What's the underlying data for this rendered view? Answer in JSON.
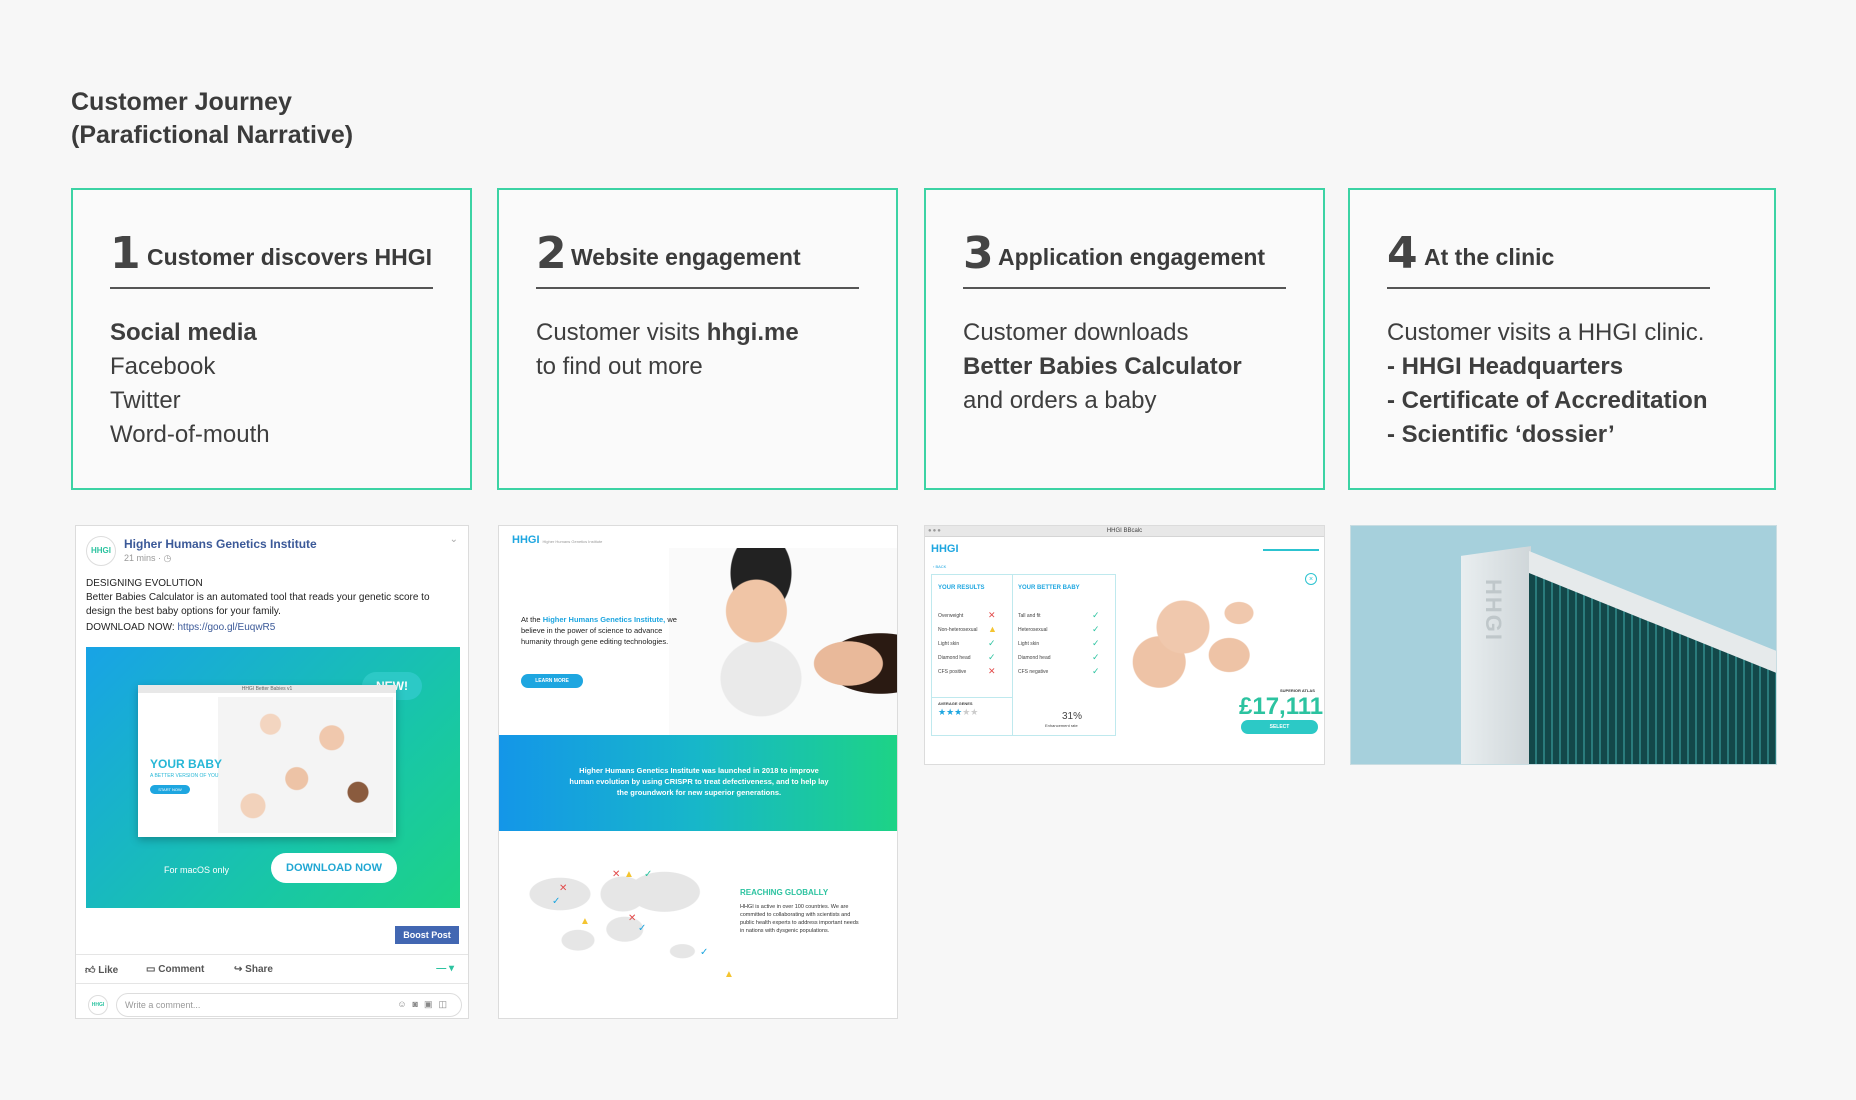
{
  "page": {
    "title_line1": "Customer Journey",
    "title_line2": "(Parafictional Narrative)"
  },
  "steps": [
    {
      "num": "1",
      "heading": "Customer discovers HHGI",
      "lines": [
        "Social media",
        "Facebook",
        "Twitter",
        "Word-of-mouth"
      ]
    },
    {
      "num": "2",
      "heading": "Website engagement",
      "line1_pre": "Customer visits ",
      "line1_bold": "hhgi.me",
      "line2": "to find out more"
    },
    {
      "num": "3",
      "heading": "Application engagement",
      "lines": [
        "Customer downloads",
        "Better Babies Calculator",
        "and orders a baby"
      ]
    },
    {
      "num": "4",
      "heading": "At the clinic",
      "lines": [
        "Customer visits a HHGI clinic.",
        "- HHGI Headquarters",
        "- Certificate of Accreditation",
        "- Scientific ‘dossier’"
      ]
    }
  ],
  "facebook": {
    "logo": "HHGI",
    "page_name": "Higher Humans Genetics Institute",
    "meta": "21 mins · ◷",
    "post_title": "DESIGNING EVOLUTION",
    "post_body": "Better Babies Calculator is an automated tool that reads your genetic score to design the best baby options for your family.",
    "download_label": "DOWNLOAD NOW: ",
    "download_link": "https://goo.gl/EuqwR5",
    "ad_badge": "NEW!",
    "ad_window_title": "HHGI Better Babies v1",
    "ad_heading": "YOUR BABY",
    "ad_sub": "A BETTER VERSION OF YOU",
    "ad_btn": "START NOW",
    "ad_mac": " For macOS only",
    "ad_download": "DOWNLOAD NOW",
    "boost": "Boost Post",
    "like": "Like",
    "comment": "Comment",
    "share": "Share",
    "comment_placeholder": "Write a comment..."
  },
  "website": {
    "logo": "HHGI",
    "logo_sub": "Higher Humans Genetics Institute",
    "hero_pre": "At the ",
    "hero_link": "Higher Humans Genetics Institute,",
    "hero_rest": "we believe in the power of science to advance humanity through gene editing technologies.",
    "learn_more": "LEARN MORE",
    "band": "Higher Humans Genetics Institute was launched in 2018 to improve human evolution by using CRISPR to treat defectiveness, and to help lay the groundwork for new superior generations.",
    "global_title": "REACHING GLOBALLY",
    "global_body": "HHGI is active in over 100 countries. We are committed to collaborating with scientists and public health experts to address important needs in nations with dysgenic populations."
  },
  "app": {
    "window_title": "HHGI BBcalc",
    "logo": "HHGI",
    "back": "‹ BACK",
    "results_title": "YOUR RESULTS",
    "better_title": "YOUR BETTER BABY",
    "results": [
      "Overweight",
      "Non-heterosexual",
      "Light skin",
      "Diamond head",
      "CFS positive"
    ],
    "better": [
      "Tall and fit",
      "Heterosexual",
      "Light skin",
      "Diamond head",
      "CFS negative"
    ],
    "rating_label": "AVERAGE GENES",
    "enh_value": "31%",
    "enh_label": "Enhancement rate",
    "price_label": "SUPERIOR ATLAS",
    "price": "£17,111",
    "select": "SELECT"
  },
  "building": {
    "sign": "HHGI"
  }
}
